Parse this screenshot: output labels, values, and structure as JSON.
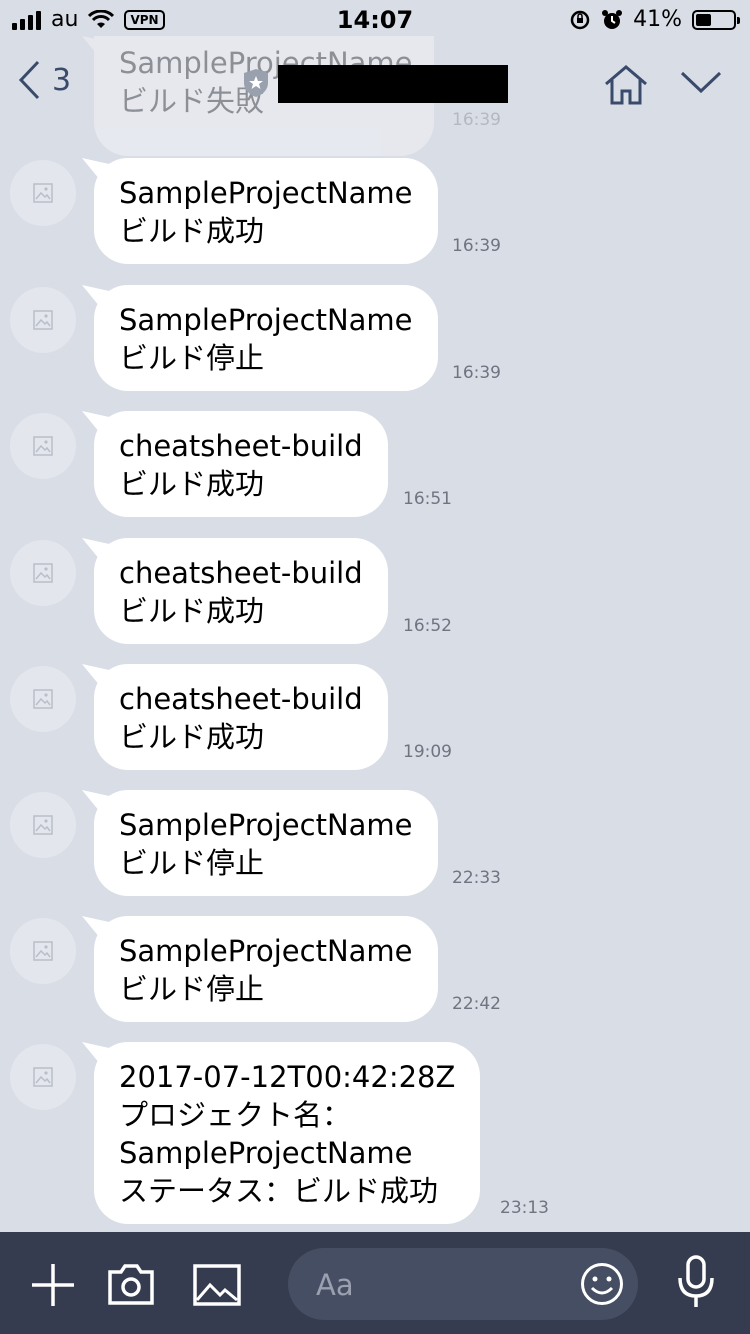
{
  "status_bar": {
    "carrier": "au",
    "vpn": "VPN",
    "time": "14:07",
    "battery": "41%",
    "battery_level": 0.41
  },
  "nav": {
    "back_count": "3",
    "partial_message": {
      "title": "SampleProjectName",
      "status": "ビルド失敗",
      "time": "16:39"
    }
  },
  "messages": [
    {
      "line1": "SampleProjectName",
      "line2": "ビルド成功",
      "time": "16:39"
    },
    {
      "line1": "SampleProjectName",
      "line2": "ビルド停止",
      "time": "16:39"
    },
    {
      "line1": "cheatsheet-build",
      "line2": "ビルド成功",
      "time": "16:51"
    },
    {
      "line1": "cheatsheet-build",
      "line2": "ビルド成功",
      "time": "16:52"
    },
    {
      "line1": "cheatsheet-build",
      "line2": "ビルド成功",
      "time": "19:09"
    },
    {
      "line1": "SampleProjectName",
      "line2": "ビルド停止",
      "time": "22:33"
    },
    {
      "line1": "SampleProjectName",
      "line2": "ビルド停止",
      "time": "22:42"
    },
    {
      "line1": "2017-07-12T00:42:28Z",
      "line2": "プロジェクト名：",
      "line3": "SampleProjectName",
      "line4": "ステータス：ビルド成功",
      "time": "23:13"
    }
  ],
  "input": {
    "placeholder": "Aa"
  },
  "colors": {
    "background": "#d9dde6",
    "bubble": "#ffffff",
    "bottom_bar": "#353c4f",
    "nav_icon": "#3a4a6b"
  }
}
